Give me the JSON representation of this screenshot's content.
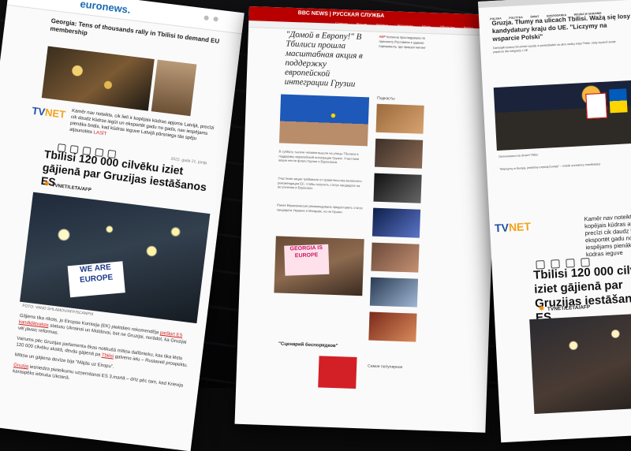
{
  "page1": {
    "logo": "euronews.",
    "en_headline": "Georgia: Tens of thousands rally in Tbilisi to demand EU membership",
    "caption_main": "Kamēr nav noteikts, cik lieli ir kopējais kūdras apjoms Latvijā, precīzi cik daudz kūdras iegūt un eksportēt gadu no gada, nav iespējams pienāks bridis, kad kūdras ieguve Latvijā pārsniegs tās spēju atjaunoties",
    "caption_more": "LASĪT",
    "brand_a": "TV",
    "brand_b": "NET",
    "date": "2022. gada 21. jūnijs",
    "title": "Tbilisi 120 000 cilvēku iziet gājienā par Gruzijas iestāšanos ES",
    "credit": "TVNET/LETA/AFP",
    "sign_text": "WE ARE EUROPE",
    "image_caption": "FOTO: VANO SHLAMOV/AFP/SCANPIX",
    "body_p1_a": "Gājiens tika rīkots, jo Eiropas Komisija (EK) piektdien rekomendēja",
    "body_p1_link": "piešķirt ES kandidātvalsts",
    "body_p1_b": "statusu Ukrainai un Moldovai, bet ne Gruzijai, norādot, ka Gruzijai vēl jāveic reformas.",
    "body_p2_a": "Vairums pēc Gruzijas parlamenta ēkas notikušā mītiņa dalībnieku, kas tika lēsts 120 000 cilvēku skaitā, devās gājienā pa",
    "body_p2_link": "Tbilisi",
    "body_p2_b": "galveno ielu – Rustaveli prospektu.",
    "body_p3": "Mītiņa un gājiena devīze bija \"Mājās uz Eiropu\".",
    "body_p4_link": "Gruzija",
    "body_p4_b": "iesniedza pieteikumu uzņemšanai ES 3.martā – drīz pēc tam, kad Krievija karaspēks iebruka Ukrainā."
  },
  "page2": {
    "bbc_logo": "BBC NEWS | РУССКАЯ СЛУЖБА",
    "nav": [
      "Главная",
      "Россия",
      "Украина",
      "Экономика",
      "Наука",
      "Общество",
      "Видео"
    ],
    "headline": "\"Домой в Европу!\" В Тбилиси прошла масштабная акция в поддержку европейской интеграции Грузии",
    "side_note_red": "АФР",
    "side_note": "Колонна проследовала по проспекту Руставели к зданию парламента, где прошел митинг",
    "list_heading": "Подкасты",
    "para1": "В субботу тысячи человек вышли на улицы Тбилиси в поддержку европейской интеграции Грузии. Участники акции несли флаги Грузии и Евросоюза.",
    "para2": "Участники акции требовали от правительства выполнить рекомендации ЕС, чтобы получить статус кандидата на вступление в Евросоюз.",
    "para3": "Ранее Еврокомиссия рекомендовала предоставить статус кандидата Украине и Молдове, но не Грузии.",
    "sign_text": "GEORGIA IS EUROPE",
    "section_title": "\"Сценарий беспорядков\"",
    "read_more": "Самое популярное"
  },
  "page3": {
    "nav": [
      "POLSKA",
      "POLITYKA",
      "ŚWIAT",
      "GOSPODARKA",
      "WOJNA W UKRAINIE"
    ],
    "headline": "Gruzja. Tłumy na ulicach Tbilisi. Ważą się losy kandydatury kraju do UE. \"Liczymy na wsparcie Polski\"",
    "para1": "Dziesiątki tysięcy Gruzinów wyszły w poniedziałek na ulice stolicy kraju Tbilisi, żeby wyrazić swoje poparcie dla integracji z UE.",
    "para2": "Demonstranci na ulicach Tbilisi.",
    "para3": "\"Wierzymy w Europę, jesteśmy częścią Europy\" – mówili uczestnicy manifestacji.",
    "brand_a": "TV",
    "brand_b": "NET",
    "caption": "Kamēr nav noteikts, cik lieli ir kopējais kūdras apjoms Latvijā, precīzi cik daudz kūdras iegūt un eksportēt gadu no gada, nav iespējams pienāks bridis, kad kūdras ieguve",
    "title": "Tbilisi 120 000 cilvēku iziet gājienā par Gruzijas iestāšanos ES",
    "credit": "TVNET/LETA/AFP"
  }
}
